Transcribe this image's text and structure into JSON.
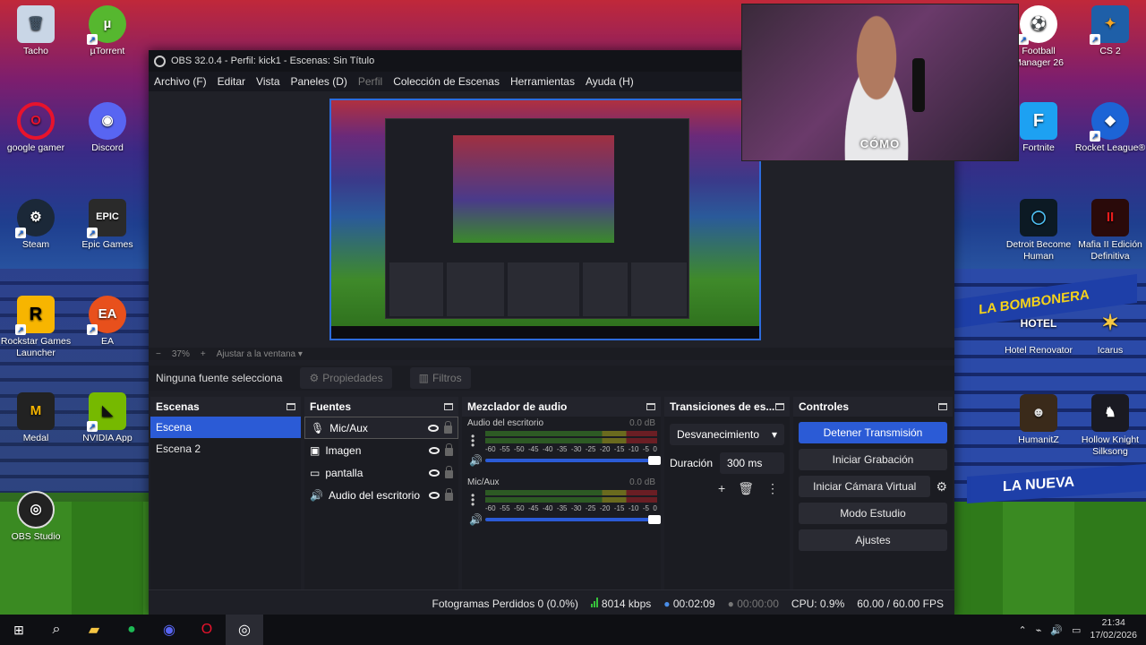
{
  "desktop": {
    "icons_left": [
      {
        "label": "Tacho",
        "glyph": "🗑"
      },
      {
        "label": "µTorrent",
        "glyph": "µ"
      },
      {
        "label": "google gamer",
        "glyph": "O"
      },
      {
        "label": "Discord",
        "glyph": "◉"
      },
      {
        "label": "Steam",
        "glyph": "⚙"
      },
      {
        "label": "Epic Games",
        "glyph": "EPIC"
      },
      {
        "label": "Rockstar Games Launcher",
        "glyph": "R"
      },
      {
        "label": "EA",
        "glyph": "EA"
      },
      {
        "label": "Medal",
        "glyph": "M"
      },
      {
        "label": "NVIDIA App",
        "glyph": "◣"
      },
      {
        "label": "OBS Studio",
        "glyph": "◎"
      }
    ],
    "icons_right": [
      {
        "label": "Football Manager 26",
        "glyph": "⚽"
      },
      {
        "label": "CS 2",
        "glyph": "✦"
      },
      {
        "label": "Fortnite",
        "glyph": "F"
      },
      {
        "label": "Rocket League®",
        "glyph": "◆"
      },
      {
        "label": "Detroit Become Human",
        "glyph": "◯"
      },
      {
        "label": "Mafia II Edición Definitiva",
        "glyph": "II"
      },
      {
        "label": "Hotel Renovator",
        "glyph": "HOTEL"
      },
      {
        "label": "Icarus",
        "glyph": "✶"
      },
      {
        "label": "HumanitZ",
        "glyph": "☻"
      },
      {
        "label": "Hollow Knight Silksong",
        "glyph": "♞"
      }
    ],
    "wallpaper_banner": "LA BOMBONERA",
    "wallpaper_banner2": "LA NUEVA"
  },
  "webcam": {
    "caption": "CÓMO"
  },
  "obs": {
    "title": "OBS 32.0.4 - Perfil: kick1 - Escenas: Sin Título",
    "menu": [
      "Archivo (F)",
      "Editar",
      "Vista",
      "Paneles (D)",
      "Perfil",
      "Colección de Escenas",
      "Herramientas",
      "Ayuda (H)"
    ],
    "zoom": {
      "minus": "−",
      "value": "37%",
      "plus": "+",
      "fit_label": "Ajustar a la ventana"
    },
    "source_bar": {
      "none_selected": "Ninguna fuente selecciona",
      "properties": "Propiedades",
      "filters": "Filtros"
    },
    "docks": {
      "scenes": {
        "title": "Escenas",
        "items": [
          "Escena",
          "Escena 2"
        ]
      },
      "sources": {
        "title": "Fuentes",
        "items": [
          "Mic/Aux",
          "Imagen",
          "pantalla",
          "Audio del escritorio"
        ]
      },
      "mixer": {
        "title": "Mezclador de audio",
        "channels": [
          {
            "name": "Audio del escritorio",
            "db": "0.0 dB"
          },
          {
            "name": "Mic/Aux",
            "db": "0.0 dB"
          }
        ],
        "scale": [
          "-60",
          "-55",
          "-50",
          "-45",
          "-40",
          "-35",
          "-30",
          "-25",
          "-20",
          "-15",
          "-10",
          "-5",
          "0"
        ]
      },
      "transitions": {
        "title": "Transiciones de es...",
        "selected": "Desvanecimiento",
        "duration_label": "Duración",
        "duration_value": "300 ms"
      },
      "controls": {
        "title": "Controles",
        "stop_stream": "Detener Transmisión",
        "start_recording": "Iniciar Grabación",
        "start_virtual_cam": "Iniciar Cámara Virtual",
        "studio_mode": "Modo Estudio",
        "settings": "Ajustes"
      }
    },
    "status": {
      "dropped_frames": "Fotogramas Perdidos 0 (0.0%)",
      "bitrate": "8014 kbps",
      "stream_time": "00:02:09",
      "record_time": "00:00:00",
      "cpu": "CPU: 0.9%",
      "fps": "60.00 / 60.00 FPS"
    },
    "colors": {
      "accent": "#2b5bd6",
      "panel": "#1e1f26",
      "bg": "#1b1c22"
    }
  },
  "taskbar": {
    "time": "21:34",
    "date": "17/02/2026"
  }
}
